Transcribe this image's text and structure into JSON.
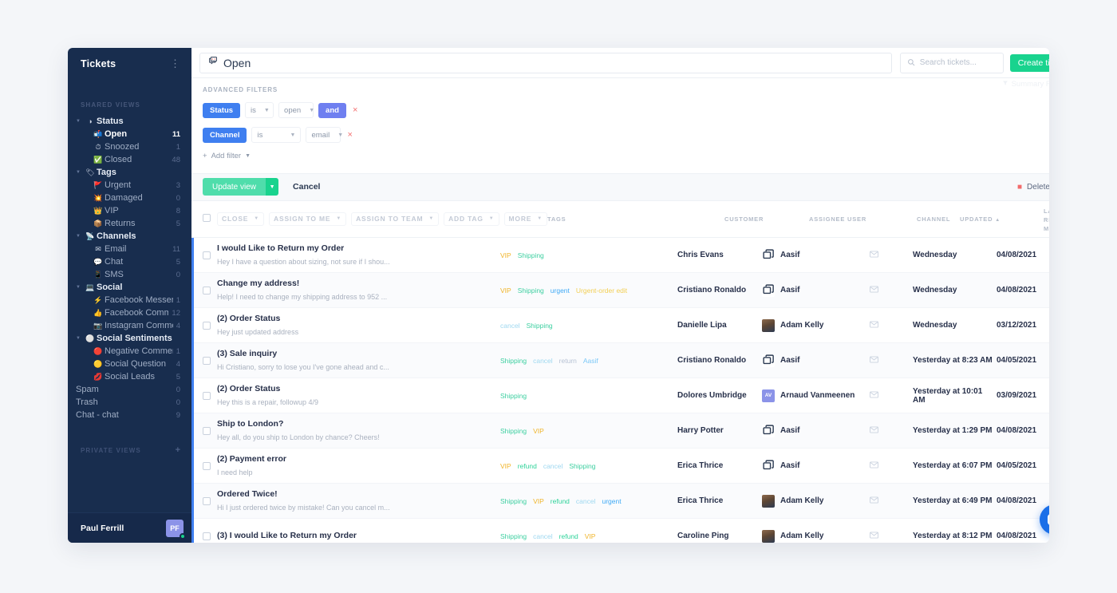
{
  "sidebar": {
    "title": "Tickets",
    "kebab_icon": "more-vertical-icon",
    "shared_views_label": "SHARED VIEWS",
    "private_views_label": "PRIVATE VIEWS",
    "add_private_view_label": "+",
    "groups": [
      {
        "type": "group",
        "label": "Status",
        "icon": "status-icon",
        "count": ""
      },
      {
        "type": "child",
        "label": "Open",
        "icon": "inbox-icon",
        "count": "11",
        "active": true
      },
      {
        "type": "child",
        "label": "Snoozed",
        "icon": "clock-icon",
        "count": "1",
        "active": false
      },
      {
        "type": "child",
        "label": "Closed",
        "icon": "check-square-icon",
        "count": "48",
        "active": false
      },
      {
        "type": "group",
        "label": "Tags",
        "icon": "tag-icon",
        "count": ""
      },
      {
        "type": "child",
        "label": "Urgent",
        "icon": "alert-icon",
        "count": "3",
        "active": false
      },
      {
        "type": "child",
        "label": "Damaged",
        "icon": "damaged-icon",
        "count": "0",
        "active": false
      },
      {
        "type": "child",
        "label": "VIP",
        "icon": "crown-icon",
        "count": "8",
        "active": false
      },
      {
        "type": "child",
        "label": "Returns",
        "icon": "return-icon",
        "count": "5",
        "active": false
      },
      {
        "type": "group",
        "label": "Channels",
        "icon": "channels-icon",
        "count": ""
      },
      {
        "type": "child",
        "label": "Email",
        "icon": "email-icon",
        "count": "11",
        "active": false
      },
      {
        "type": "child",
        "label": "Chat",
        "icon": "chat-icon",
        "count": "5",
        "active": false
      },
      {
        "type": "child",
        "label": "SMS",
        "icon": "sms-icon",
        "count": "0",
        "active": false
      },
      {
        "type": "group",
        "label": "Social",
        "icon": "social-icon",
        "count": ""
      },
      {
        "type": "child",
        "label": "Facebook Messenger",
        "icon": "messenger-icon",
        "count": "1",
        "active": false
      },
      {
        "type": "child",
        "label": "Facebook Comments",
        "icon": "facebook-icon",
        "count": "12",
        "active": false
      },
      {
        "type": "child",
        "label": "Instagram Comments",
        "icon": "instagram-icon",
        "count": "4",
        "active": false
      },
      {
        "type": "group",
        "label": "Social Sentiments",
        "icon": "sentiment-icon",
        "count": ""
      },
      {
        "type": "child",
        "label": "Negative Comments",
        "icon": "negative-icon",
        "count": "1",
        "active": false
      },
      {
        "type": "child",
        "label": "Social Question",
        "icon": "question-icon",
        "count": "4",
        "active": false
      },
      {
        "type": "child",
        "label": "Social Leads",
        "icon": "leads-icon",
        "count": "5",
        "active": false
      },
      {
        "type": "plain",
        "label": "Spam",
        "icon": "",
        "count": "0",
        "active": false
      },
      {
        "type": "plain",
        "label": "Trash",
        "icon": "",
        "count": "0",
        "active": false
      },
      {
        "type": "plain",
        "label": "Chat - chat",
        "icon": "",
        "count": "9",
        "active": false
      }
    ],
    "user": {
      "name": "Paul Ferrill",
      "initials": "PF",
      "status": "online"
    }
  },
  "topbar": {
    "view_icon": "inbox-icon",
    "view_name": "Open",
    "search_placeholder": "Search tickets...",
    "search_value": "",
    "search_icon": "search-icon",
    "create_ticket_label": "Create ticket"
  },
  "filters": {
    "heading": "ADVANCED FILTERS",
    "summary_filters_label": "Summary Filters",
    "summary_filters_icon": "funnel-icon",
    "rows": [
      {
        "field": "Status",
        "operator": "is",
        "value": "open",
        "conjunction": "and",
        "remove_icon": "close-icon"
      },
      {
        "field": "Channel",
        "operator": "is",
        "value": "email",
        "conjunction": "",
        "remove_icon": "close-icon"
      }
    ],
    "add_filter_label": "Add filter",
    "add_filter_icon": "plus-icon"
  },
  "actionbar": {
    "update_label": "Update view",
    "update_caret_icon": "chevron-down-icon",
    "cancel_label": "Cancel",
    "delete_label": "Delete view",
    "delete_icon": "trash-icon"
  },
  "bulkbar": {
    "close_label": "Close",
    "assign_me_label": "Assign to me",
    "assign_team_label": "Assign to team",
    "add_tag_label": "Add tag",
    "more_label": "More"
  },
  "table": {
    "columns": {
      "tags": "TAGS",
      "customer": "CUSTOMER",
      "assignee": "ASSIGNEE USER",
      "channel": "CHANNEL",
      "updated": "UPDATED",
      "updated_sort_icon": "sort-asc-icon",
      "last_received": "LAST RECEIVED MESSAGE"
    },
    "rows": [
      {
        "subject": "I would Like to Return my Order",
        "preview": "Hey I have a question about sizing, not sure if I shou...",
        "tags": [
          {
            "label": "VIP",
            "cls": "t-vip"
          },
          {
            "label": "Shipping",
            "cls": "t-shipping"
          }
        ],
        "customer": "Chris Evans",
        "assignee": "Aasif",
        "avatar_type": "icon",
        "avatar_initials": "",
        "channel_icon": "email-icon",
        "updated": "Wednesday",
        "last_received": "04/08/2021"
      },
      {
        "subject": "Change my address!",
        "preview": "Help! I need to change my shipping address to 952 ...",
        "tags": [
          {
            "label": "VIP",
            "cls": "t-vip"
          },
          {
            "label": "Shipping",
            "cls": "t-shipping"
          },
          {
            "label": "urgent",
            "cls": "t-urgent"
          },
          {
            "label": "Urgent-order edit",
            "cls": "t-orderedit"
          }
        ],
        "customer": "Cristiano Ronaldo",
        "assignee": "Aasif",
        "avatar_type": "icon",
        "avatar_initials": "",
        "channel_icon": "email-icon",
        "updated": "Wednesday",
        "last_received": "04/08/2021"
      },
      {
        "subject": "(2) Order Status",
        "preview": "Hey just updated address",
        "tags": [
          {
            "label": "cancel",
            "cls": "t-cancel"
          },
          {
            "label": "Shipping",
            "cls": "t-shipping"
          }
        ],
        "customer": "Danielle Lipa",
        "assignee": "Adam Kelly",
        "avatar_type": "photo",
        "avatar_initials": "",
        "channel_icon": "email-icon",
        "updated": "Wednesday",
        "last_received": "03/12/2021"
      },
      {
        "subject": "(3) Sale inquiry",
        "preview": "Hi Cristiano, sorry to lose you I've gone ahead and c...",
        "tags": [
          {
            "label": "Shipping",
            "cls": "t-shipping"
          },
          {
            "label": "cancel",
            "cls": "t-cancel"
          },
          {
            "label": "return",
            "cls": "t-return"
          },
          {
            "label": "Aasif",
            "cls": "t-aasif"
          }
        ],
        "customer": "Cristiano Ronaldo",
        "assignee": "Aasif",
        "avatar_type": "icon",
        "avatar_initials": "",
        "channel_icon": "email-icon",
        "updated": "Yesterday at 8:23 AM",
        "last_received": "04/05/2021"
      },
      {
        "subject": "(2) Order Status",
        "preview": "Hey this is a repair, followup 4/9",
        "tags": [
          {
            "label": "Shipping",
            "cls": "t-shipping"
          }
        ],
        "customer": "Dolores Umbridge",
        "assignee": "Arnaud Vanmeenen",
        "avatar_type": "initials",
        "avatar_initials": "AV",
        "channel_icon": "email-icon",
        "updated": "Yesterday at 10:01 AM",
        "last_received": "03/09/2021"
      },
      {
        "subject": "Ship to London?",
        "preview": "Hey all, do you ship to London by chance? Cheers!",
        "tags": [
          {
            "label": "Shipping",
            "cls": "t-shipping"
          },
          {
            "label": "VIP",
            "cls": "t-vip"
          }
        ],
        "customer": "Harry Potter",
        "assignee": "Aasif",
        "avatar_type": "icon",
        "avatar_initials": "",
        "channel_icon": "email-icon",
        "updated": "Yesterday at 1:29 PM",
        "last_received": "04/08/2021"
      },
      {
        "subject": "(2) Payment error",
        "preview": "I need help",
        "tags": [
          {
            "label": "VIP",
            "cls": "t-vip"
          },
          {
            "label": "refund",
            "cls": "t-refund"
          },
          {
            "label": "cancel",
            "cls": "t-cancel"
          },
          {
            "label": "Shipping",
            "cls": "t-shipping"
          }
        ],
        "customer": "Erica Thrice",
        "assignee": "Aasif",
        "avatar_type": "icon",
        "avatar_initials": "",
        "channel_icon": "email-icon",
        "updated": "Yesterday at 6:07 PM",
        "last_received": "04/05/2021"
      },
      {
        "subject": "Ordered Twice!",
        "preview": "Hi I just ordered twice by mistake! Can you cancel m...",
        "tags": [
          {
            "label": "Shipping",
            "cls": "t-shipping"
          },
          {
            "label": "VIP",
            "cls": "t-vip"
          },
          {
            "label": "refund",
            "cls": "t-refund"
          },
          {
            "label": "cancel",
            "cls": "t-cancel"
          },
          {
            "label": "urgent",
            "cls": "t-urgent"
          }
        ],
        "customer": "Erica Thrice",
        "assignee": "Adam Kelly",
        "avatar_type": "photo",
        "avatar_initials": "",
        "channel_icon": "email-icon",
        "updated": "Yesterday at 6:49 PM",
        "last_received": "04/08/2021"
      },
      {
        "subject": "(3) I would Like to Return my Order",
        "preview": "",
        "tags": [
          {
            "label": "Shipping",
            "cls": "t-shipping"
          },
          {
            "label": "cancel",
            "cls": "t-cancel"
          },
          {
            "label": "refund",
            "cls": "t-refund"
          },
          {
            "label": "VIP",
            "cls": "t-vip"
          }
        ],
        "customer": "Caroline Ping",
        "assignee": "Adam Kelly",
        "avatar_type": "photo",
        "avatar_initials": "",
        "channel_icon": "email-icon",
        "updated": "Yesterday at 8:12 PM",
        "last_received": "04/08/2021"
      }
    ]
  },
  "chat_widget": {
    "icon": "chat-bubble-icon"
  },
  "colors": {
    "sidebar_bg": "#182d4e",
    "accent_green": "#19d38e",
    "accent_blue": "#3f7ff0",
    "conjunction_purple": "#6f7ff0",
    "danger": "#f26b6b"
  }
}
